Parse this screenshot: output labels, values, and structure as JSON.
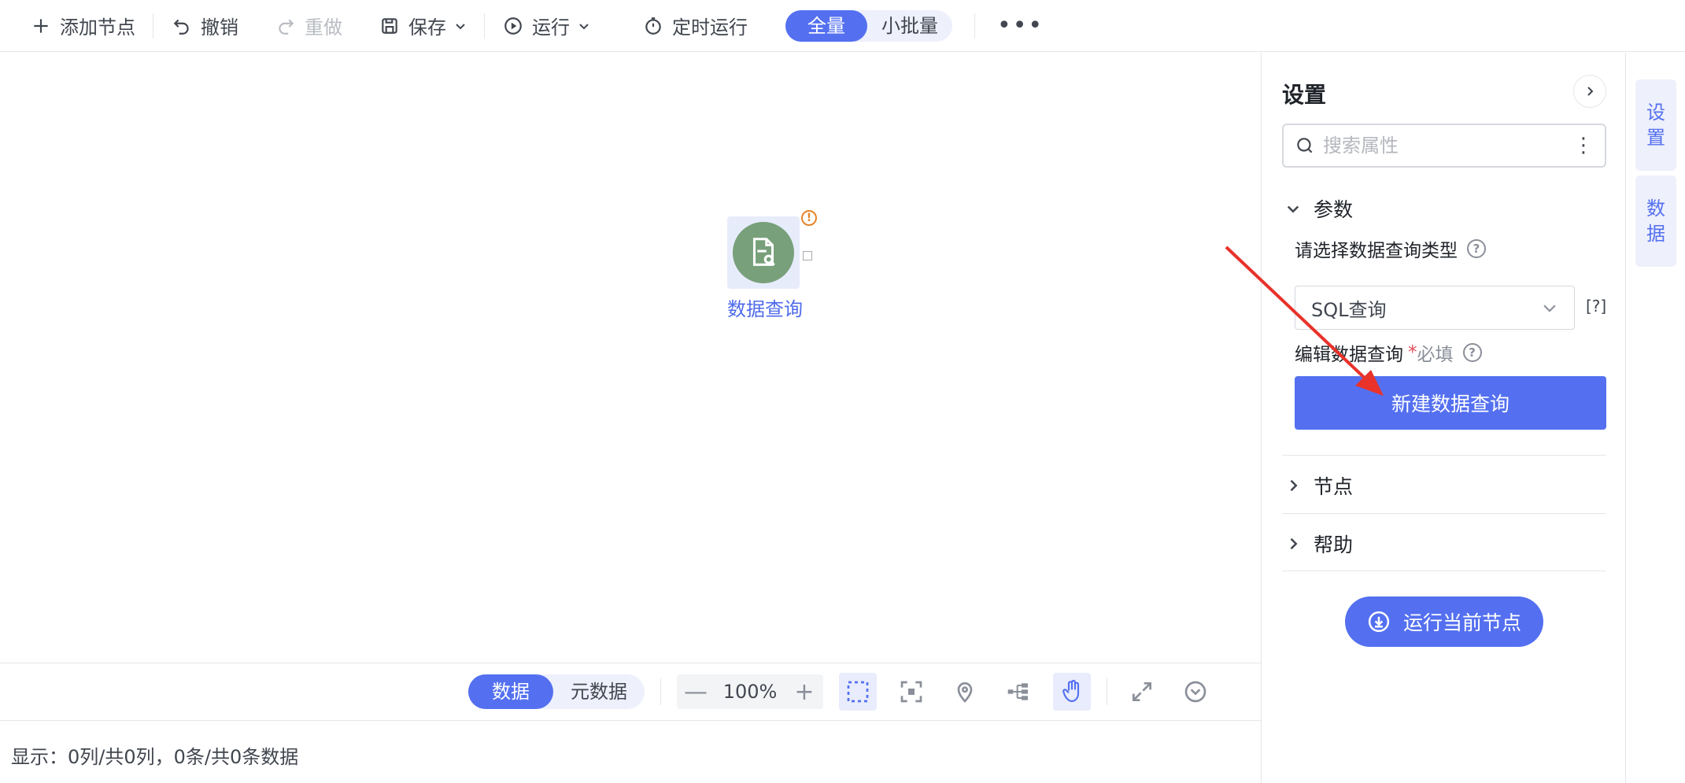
{
  "toolbar": {
    "add_node": "添加节点",
    "undo": "撤销",
    "redo": "重做",
    "save": "保存",
    "run": "运行",
    "scheduled_run": "定时运行",
    "mode_options": [
      "全量",
      "小批量"
    ],
    "mode_selected": "全量"
  },
  "canvas": {
    "node": {
      "label": "数据查询",
      "icon": "document-search-icon",
      "status": "warning",
      "color": "#78a07a"
    }
  },
  "bottom_bar": {
    "view_options": [
      "数据",
      "元数据"
    ],
    "view_selected": "数据",
    "zoom": "100%"
  },
  "status_text": "显示：0列/共0列，0条/共0条数据",
  "settings": {
    "title": "设置",
    "search_placeholder": "搜索属性",
    "sections": {
      "params": "参数",
      "node": "节点",
      "help": "帮助"
    },
    "query_type_label": "请选择数据查询类型",
    "query_type_value": "SQL查询",
    "expr_button": "[?]",
    "edit_query_label": "编辑数据查询",
    "required_mark": "*",
    "required_text": "必填",
    "new_query_button": "新建数据查询",
    "run_current_button": "运行当前节点"
  },
  "side_tabs": [
    {
      "label": "设\n置"
    },
    {
      "label": "数\n据"
    }
  ],
  "colors": {
    "accent": "#5470f0",
    "annotation_arrow": "#e8322a"
  }
}
